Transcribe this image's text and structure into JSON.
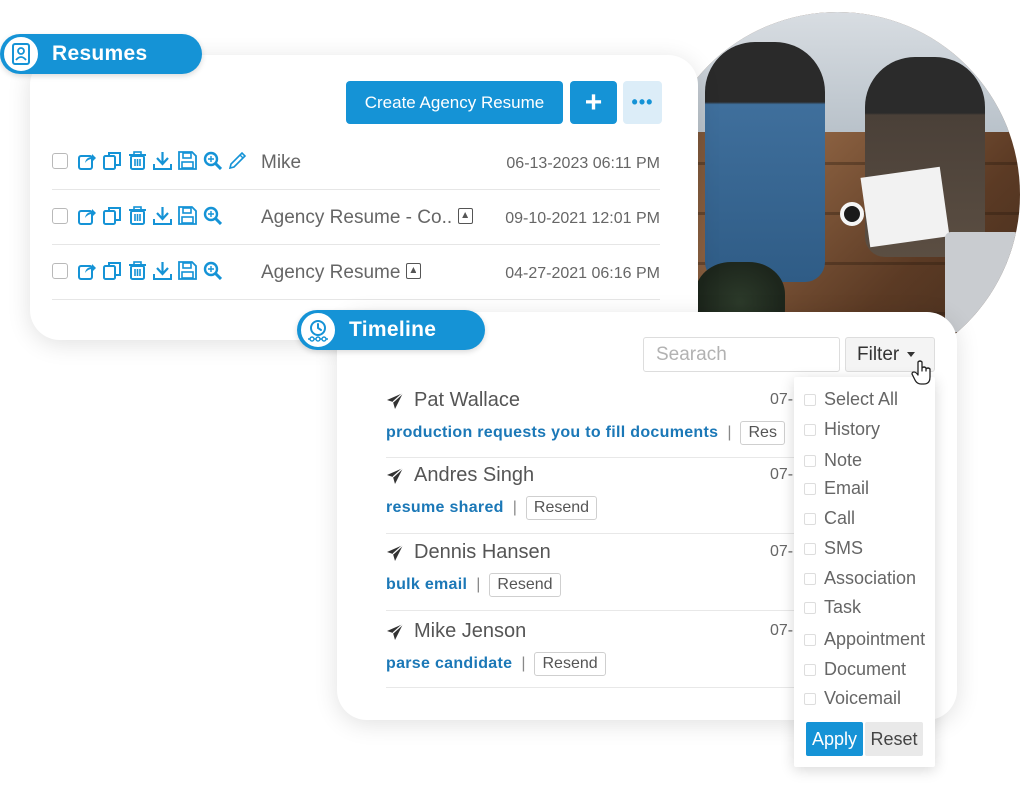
{
  "resumes": {
    "title": "Resumes",
    "create_button": "Create Agency Resume",
    "add_button": "+",
    "more_button": "•••",
    "rows": [
      {
        "name": "Mike",
        "date": "06-13-2023 06:11 PM",
        "has_edit": true,
        "has_badge": false
      },
      {
        "name": "Agency Resume - Co..",
        "date": "09-10-2021 12:01 PM",
        "has_edit": false,
        "has_badge": true
      },
      {
        "name": "Agency Resume",
        "date": "04-27-2021 06:16 PM",
        "has_edit": false,
        "has_badge": true
      }
    ]
  },
  "timeline": {
    "title": "Timeline",
    "search_placeholder": "Searach",
    "filter_label": "Filter",
    "items": [
      {
        "name": "Pat Wallace",
        "action": "production requests you to fill documents",
        "sep": "|",
        "resend": "Res",
        "date": "07-"
      },
      {
        "name": "Andres Singh",
        "action": "resume shared",
        "sep": "|",
        "resend": "Resend",
        "date": "07-"
      },
      {
        "name": "Dennis Hansen",
        "action": "bulk email",
        "sep": "|",
        "resend": "Resend",
        "date": "07-"
      },
      {
        "name": "Mike Jenson",
        "action": "parse candidate",
        "sep": "|",
        "resend": "Resend",
        "date": "07-"
      }
    ]
  },
  "filter_menu": {
    "options": [
      "Select All",
      "History",
      "Note",
      "Email",
      "Call",
      "SMS",
      "Association",
      "Task",
      "Appointment",
      "Document",
      "Voicemail"
    ],
    "apply": "Apply",
    "reset": "Reset"
  },
  "colors": {
    "accent": "#1593d6",
    "link": "#1b78b7"
  }
}
